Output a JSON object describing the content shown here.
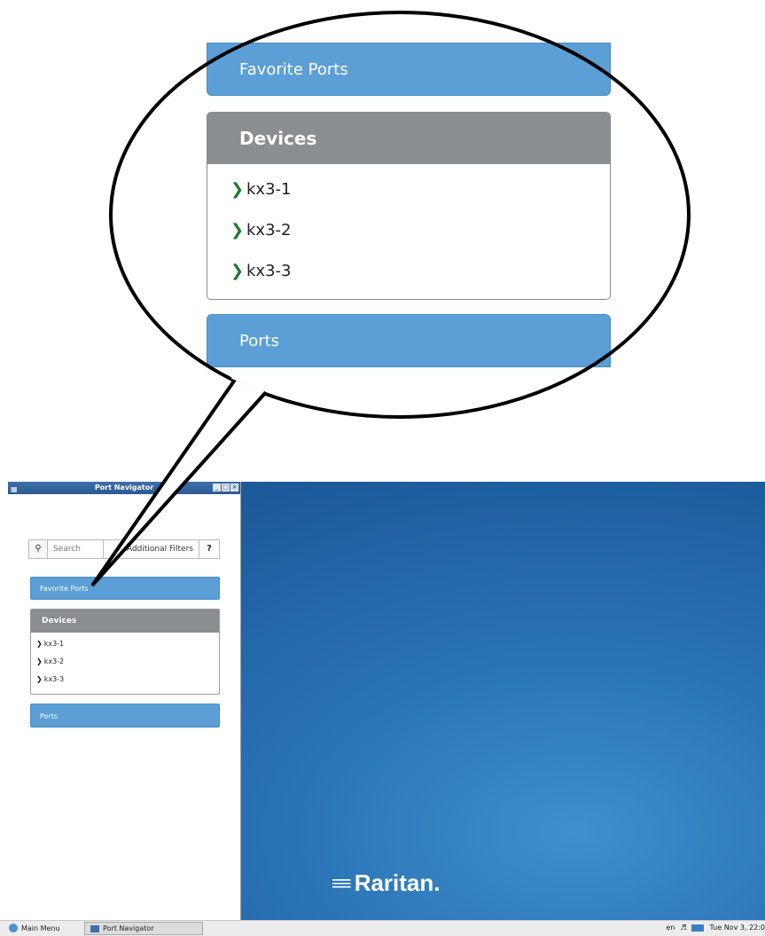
{
  "callout": {
    "favorite_label": "Favorite Ports",
    "devices_header": "Devices",
    "devices": [
      "kx3-1",
      "kx3-2",
      "kx3-3"
    ],
    "ports_label": "Ports"
  },
  "window": {
    "title": "Port Navigator",
    "controls": [
      "_",
      "□",
      "×"
    ]
  },
  "toolbar": {
    "search_placeholder": "Search",
    "filters_label": "Additional Filters",
    "help_icon": "?"
  },
  "nav": {
    "favorite_label": "Favorite Ports",
    "devices_header": "Devices",
    "devices": [
      "kx3-1",
      "kx3-2",
      "kx3-3"
    ],
    "ports_label": "Ports"
  },
  "branding": {
    "logo_text": "Raritan."
  },
  "taskbar": {
    "main_menu": "Main Menu",
    "task_label": "Port Navigator",
    "lang": "en",
    "clock": "Tue Nov  3, 22:0"
  },
  "colors": {
    "accent_blue": "#5b9fd6",
    "devices_header_gray": "#8b8e91",
    "chevron_green": "#1e7a2d",
    "desktop_blue": "#2a74b6"
  }
}
